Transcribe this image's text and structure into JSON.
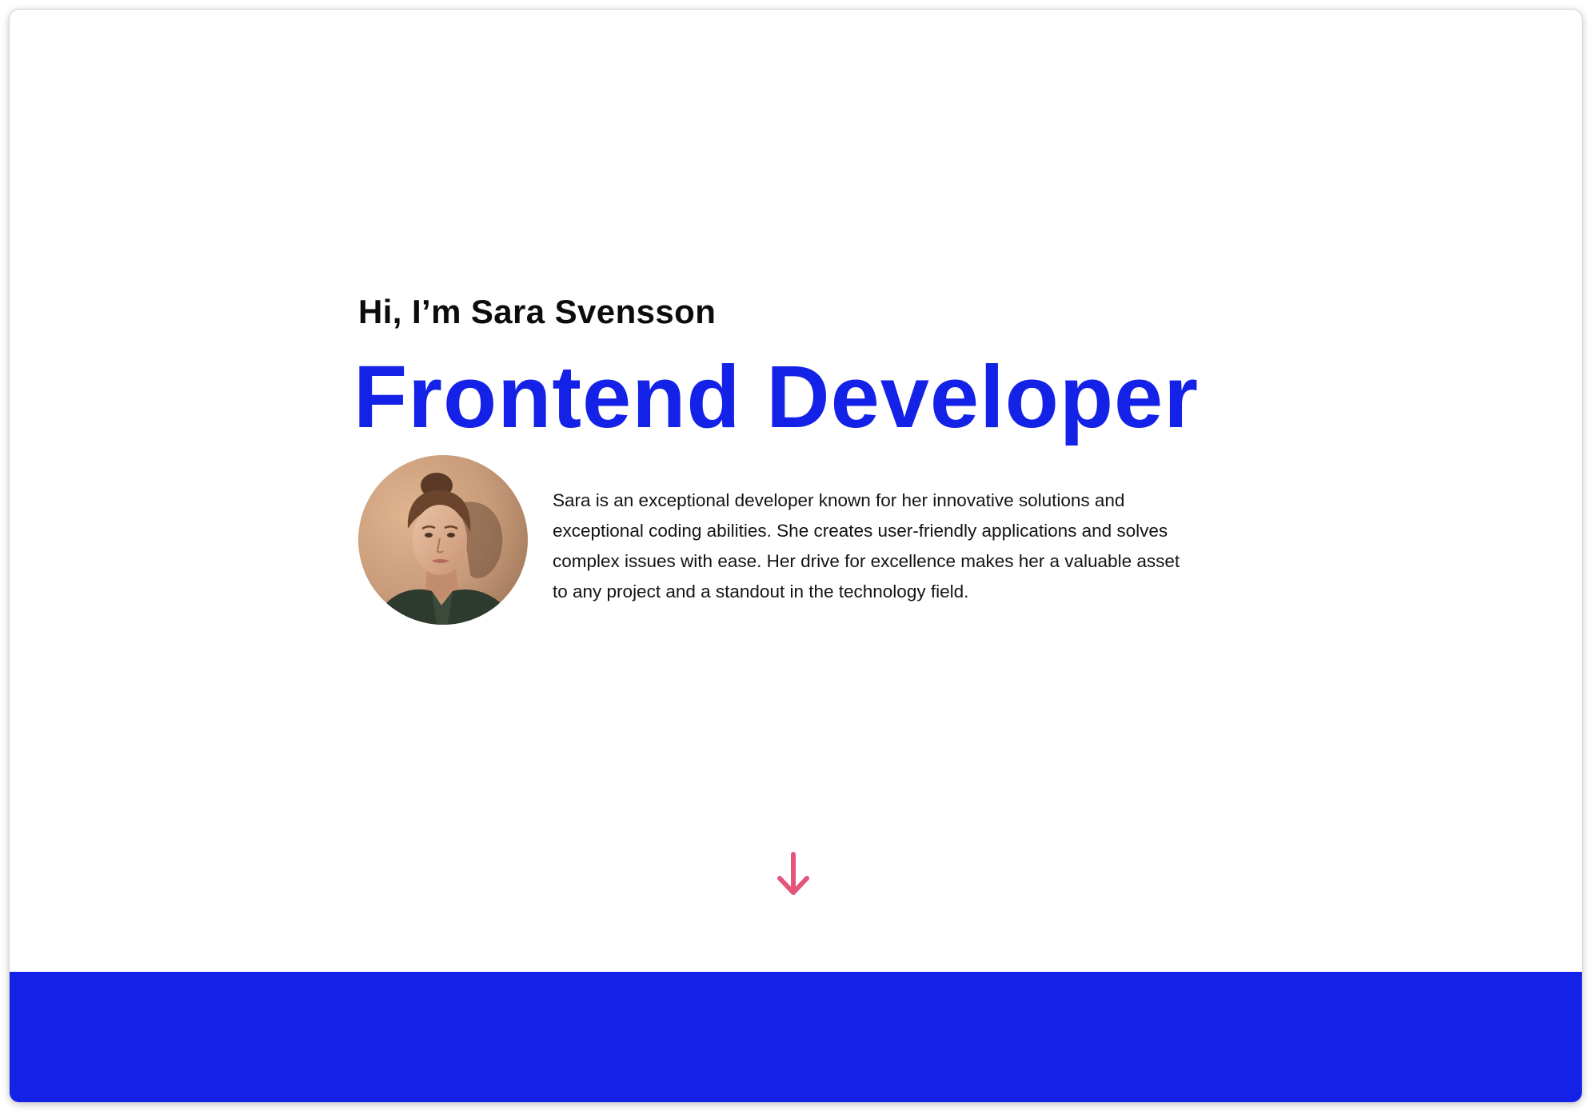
{
  "hero": {
    "greeting": "Hi, I’m Sara Svensson",
    "role_title": "Frontend Developer",
    "bio": "Sara is an exceptional developer known for her innovative solutions and exceptional coding abilities. She creates user-friendly applications and solves complex issues with ease. Her drive for excellence makes her a valuable asset to any project and a standout in the technology field.",
    "avatar_icon": "portrait-photo",
    "scroll_icon": "arrow-down-icon"
  },
  "colors": {
    "accent_blue": "#1322e6",
    "arrow_pink": "#e4557a",
    "text_dark": "#0c0c0c",
    "background": "#ffffff"
  }
}
